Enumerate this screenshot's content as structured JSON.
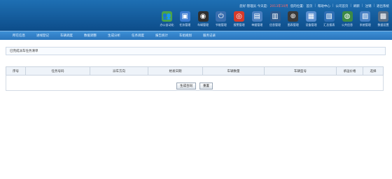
{
  "top_links": {
    "prefix": "您好:管理员 今天是:",
    "date": "2013年10月",
    "position": "您的位置:",
    "home": "首页",
    "links": [
      "帮助中心",
      "公司首页",
      "刷新",
      "注销",
      "退出系统"
    ]
  },
  "toolbar": [
    {
      "label": "办公自动化",
      "icon": "people-icon",
      "color": "#4aa34a",
      "glyph": "👥"
    },
    {
      "label": "任务管理",
      "icon": "monitor-icon",
      "color": "#3b7bd1",
      "glyph": "▣"
    },
    {
      "label": "车辆管理",
      "icon": "gauge-icon",
      "color": "#2f2f2f",
      "glyph": "◉"
    },
    {
      "label": "节能管理",
      "icon": "power-icon",
      "color": "#3a6fb0",
      "glyph": "⏻"
    },
    {
      "label": "报警管理",
      "icon": "alarm-icon",
      "color": "#d63a2a",
      "glyph": "◎"
    },
    {
      "label": "单据管理",
      "icon": "document-icon",
      "color": "#4a7fc0",
      "glyph": "▤"
    },
    {
      "label": "信息管理",
      "icon": "book-icon",
      "color": "#2c5a8f",
      "glyph": "▥"
    },
    {
      "label": "图表管理",
      "icon": "gps-icon",
      "color": "#3a3a3a",
      "glyph": "⊕"
    },
    {
      "label": "设备管理",
      "icon": "device-icon",
      "color": "#5a8fd0",
      "glyph": "▦"
    },
    {
      "label": "汇总报表",
      "icon": "report-icon",
      "color": "#2f6fb5",
      "glyph": "▧"
    },
    {
      "label": "公共信息",
      "icon": "globe-icon",
      "color": "#3c8a46",
      "glyph": "◍"
    },
    {
      "label": "系统管理",
      "icon": "settings-icon",
      "color": "#4780c4",
      "glyph": "▨"
    },
    {
      "label": "数据设置",
      "icon": "database-icon",
      "color": "#5a6f86",
      "glyph": "▩"
    }
  ],
  "nav": [
    "所在信息",
    "进线登记",
    "车辆调度",
    "数据调整",
    "生成分析",
    "任务调度",
    "报告统计",
    "车组规划",
    "服务记录"
  ],
  "section_title": "已完成派车任务清单",
  "table": {
    "headers": [
      "序号",
      "任务号码",
      "派车方向",
      "始发日期",
      "车辆数量",
      "车辆型号",
      "承运价格",
      "选择"
    ]
  },
  "buttons": {
    "generate": "生成合同",
    "reset": "重置"
  }
}
